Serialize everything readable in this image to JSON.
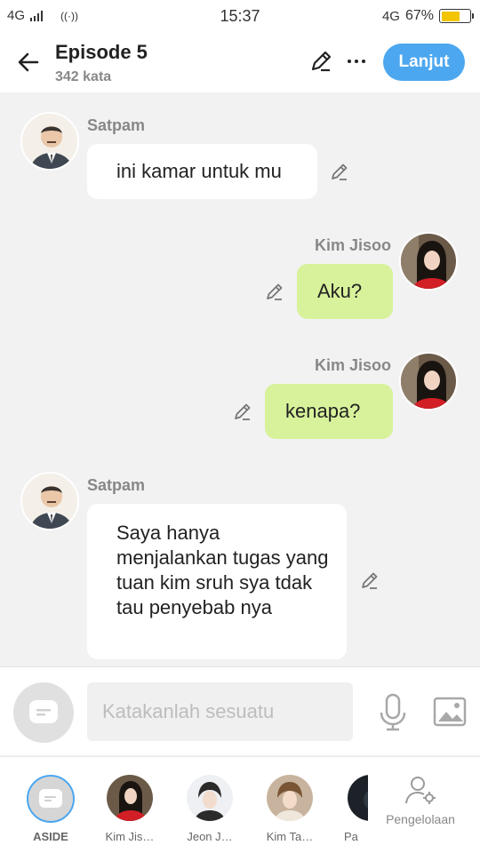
{
  "status_bar": {
    "network": "4G",
    "time": "15:37",
    "network_right": "4G",
    "battery_percent": "67%",
    "battery_level": 0.67,
    "battery_color": "#f2c500"
  },
  "header": {
    "back_icon": "arrow-left-icon",
    "title": "Episode 5",
    "subtitle": "342 kata",
    "edit_icon": "pencil-icon",
    "more_icon": "more-horizontal-icon",
    "next_label": "Lanjut",
    "accent_color": "#4ca7f0"
  },
  "messages": [
    {
      "side": "left",
      "speaker": "Satpam",
      "text": "ini kamar untuk mu"
    },
    {
      "side": "right",
      "speaker": "Kim Jisoo",
      "text": "Aku?"
    },
    {
      "side": "right",
      "speaker": "Kim Jisoo",
      "text": "kenapa?"
    },
    {
      "side": "left",
      "speaker": "Satpam",
      "text": "Saya hanya menjalankan tugas yang tuan kim sruh sya tdak tau penyebab nya"
    }
  ],
  "bubble_colors": {
    "left": "#ffffff",
    "right": "#d8f29b"
  },
  "input_bar": {
    "mode_icon": "chat-bubble-icon",
    "placeholder": "Katakanlah sesuatu",
    "value": "",
    "mic_icon": "microphone-icon",
    "image_icon": "image-icon"
  },
  "characters": [
    {
      "label": "ASIDE",
      "icon": "chat-bubble-icon",
      "selected": true
    },
    {
      "label": "Kim Jis…"
    },
    {
      "label": "Jeon J…"
    },
    {
      "label": "Kim Ta…"
    },
    {
      "label": "Pa"
    }
  ],
  "manage": {
    "label": "Pengelolaan",
    "icon": "user-settings-icon"
  }
}
